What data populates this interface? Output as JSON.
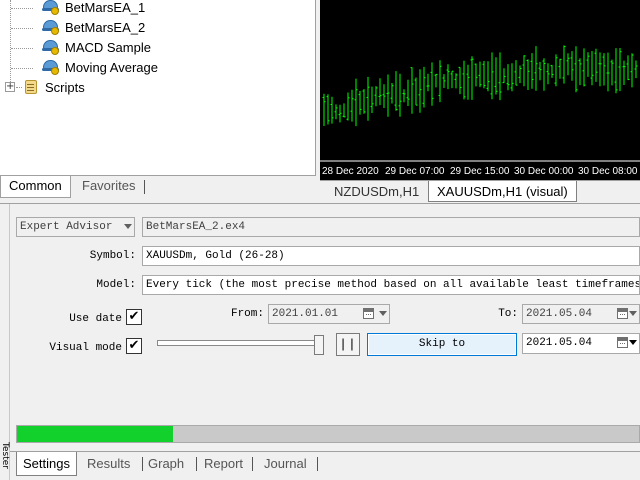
{
  "navigator": {
    "items": [
      {
        "label": "BetMarsEA_1",
        "icon": "expert-advisor-icon"
      },
      {
        "label": "BetMarsEA_2",
        "icon": "expert-advisor-icon"
      },
      {
        "label": "MACD Sample",
        "icon": "expert-advisor-icon"
      },
      {
        "label": "Moving Average",
        "icon": "expert-advisor-icon"
      }
    ],
    "scripts_label": "Scripts",
    "expander_glyph": "+",
    "tabs": [
      {
        "label": "Common",
        "active": true
      },
      {
        "label": "Favorites",
        "active": false
      }
    ]
  },
  "chart": {
    "background": "#000000",
    "bar_color": "#00ff00",
    "time_labels": [
      "28 Dec 2020",
      "29 Dec 07:00",
      "29 Dec 15:00",
      "30 Dec 00:00",
      "30 Dec 08:00"
    ],
    "tabs": [
      {
        "label": "NZDUSDm,H1",
        "active": false
      },
      {
        "label": "XAUUSDm,H1 (visual)",
        "active": true
      }
    ]
  },
  "tester": {
    "type_select": "Expert Advisor",
    "ea_file": "BetMarsEA_2.ex4",
    "symbol_label": "Symbol:",
    "symbol_value": "XAUUSDm, Gold (26-28)",
    "model_label": "Model:",
    "model_value": "Every tick (the most precise method based on all available least timeframes to generate each tick)",
    "use_date_label": "Use date",
    "use_date_checked": "✔",
    "from_label": "From:",
    "from_value": "2021.01.01",
    "to_label": "To:",
    "to_value": "2021.05.04",
    "visual_mode_label": "Visual mode",
    "visual_mode_checked": "✔",
    "visual_speed_fraction": 1.0,
    "pause_label": "| |",
    "skip_to_label": "Skip to",
    "skip_to_value": "2021.05.04",
    "progress_fraction": 0.25,
    "progress_color": "#12d12c",
    "strip_label": "Tester",
    "tabs": [
      {
        "label": "Settings",
        "active": true
      },
      {
        "label": "Results",
        "active": false
      },
      {
        "label": "Graph",
        "active": false
      },
      {
        "label": "Report",
        "active": false
      },
      {
        "label": "Journal",
        "active": false
      }
    ]
  }
}
